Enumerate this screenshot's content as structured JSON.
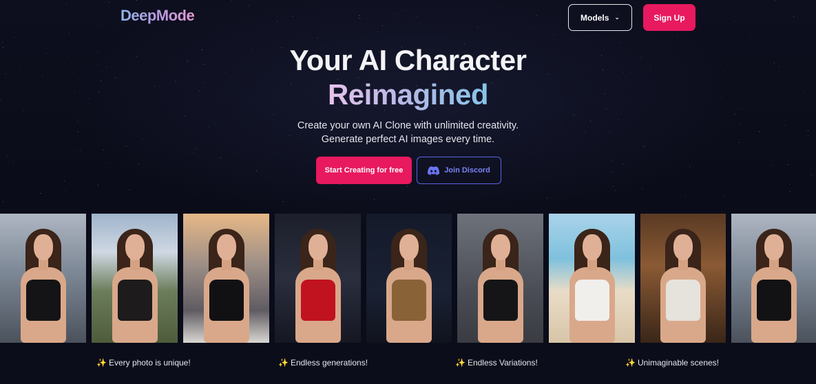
{
  "header": {
    "logo": "DeepMode",
    "models_label": "Models",
    "signup_label": "Sign Up"
  },
  "hero": {
    "title_line1": "Your AI Character",
    "title_line2": "Reimagined",
    "subtitle_line1": "Create your own AI Clone with unlimited creativity.",
    "subtitle_line2": "Generate perfect AI images every time.",
    "cta_primary": "Start Creating for free",
    "cta_discord": "Join Discord"
  },
  "colors": {
    "accent": "#e8195f",
    "discord": "#5b63e6",
    "background": "#0b0d1a"
  },
  "gallery": {
    "tiles": [
      {
        "bg": "city-street",
        "outfit": "black-dress-jacket"
      },
      {
        "bg": "mountains",
        "outfit": "black-bikini"
      },
      {
        "bg": "city-rooftop-dusk",
        "outfit": "black-dress"
      },
      {
        "bg": "red-carpet-night",
        "outfit": "red-dress"
      },
      {
        "bg": "dark-backdrop",
        "outfit": "leopard-top"
      },
      {
        "bg": "grey-backdrop",
        "outfit": "black-leather"
      },
      {
        "bg": "beach",
        "outfit": "white-bikini"
      },
      {
        "bg": "warm-room",
        "outfit": "white-top"
      },
      {
        "bg": "city-street",
        "outfit": "black-bikini-top"
      }
    ]
  },
  "captions": [
    "Every photo is unique!",
    "Endless generations!",
    "Endless Variations!",
    "Unimaginable scenes!"
  ],
  "icons": {
    "caption_icon": "sparkles-icon",
    "discord_icon": "discord-icon",
    "models_icon": "chevron-down-icon"
  }
}
